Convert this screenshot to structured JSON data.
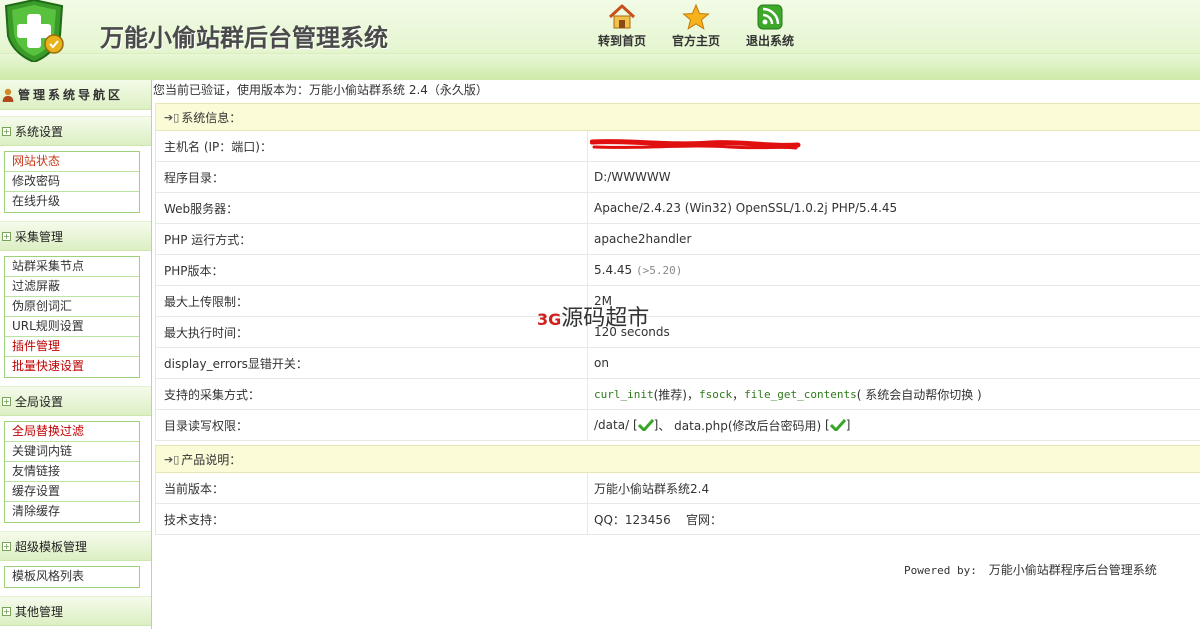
{
  "app": {
    "title": "万能小偷站群后台管理系统"
  },
  "topnav": [
    {
      "label": "转到首页",
      "icon": "home-icon"
    },
    {
      "label": "官方主页",
      "icon": "star-icon"
    },
    {
      "label": "退出系统",
      "icon": "rss-icon"
    }
  ],
  "sidebar": {
    "header": "管理系统导航区",
    "sections": [
      {
        "title": "系统设置",
        "items": [
          "网站状态",
          "修改密码",
          "在线升级"
        ]
      },
      {
        "title": "采集管理",
        "items": [
          "站群采集节点",
          "过滤屏蔽",
          "伪原创词汇",
          "URL规则设置",
          "插件管理",
          "批量快速设置"
        ]
      },
      {
        "title": "全局设置",
        "items": [
          "全局替换过滤",
          "关键词内链",
          "友情链接",
          "缓存设置",
          "清除缓存"
        ]
      },
      {
        "title": "超级模板管理",
        "items": [
          "模板风格列表"
        ]
      },
      {
        "title": "其他管理",
        "items": []
      }
    ]
  },
  "main": {
    "notice": "您当前已验证，使用版本为：万能小偷站群系统 2.4（永久版）",
    "sysinfo": {
      "title": "系统信息：",
      "rows": [
        {
          "label": "主机名 (IP：端口)：",
          "value": ""
        },
        {
          "label": "程序目录：",
          "value": "D:/WWWWW"
        },
        {
          "label": "Web服务器：",
          "value": "Apache/2.4.23 (Win32) OpenSSL/1.0.2j PHP/5.4.45"
        },
        {
          "label": "PHP 运行方式：",
          "value": "apache2handler"
        },
        {
          "label": "PHP版本：",
          "value": "5.4.45",
          "note": "(>5.20)"
        },
        {
          "label": "最大上传限制：",
          "value": "2M"
        },
        {
          "label": "最大执行时间：",
          "value": "120 seconds"
        },
        {
          "label": "display_errors显错开关：",
          "value": "on"
        },
        {
          "label": "支持的采集方式：",
          "methods": [
            "curl_init",
            "fsock",
            "file_get_contents"
          ],
          "recommend": "(推荐)",
          "sep": "，",
          "note": "( 系统会自动帮你切换 )"
        },
        {
          "label": "目录读写权限：",
          "dir1": "/data/",
          "dir2": "data.php(修改后台密码用)",
          "sep": "、"
        }
      ]
    },
    "product": {
      "title": "产品说明：",
      "rows": [
        {
          "label": "当前版本：",
          "value": "万能小偷站群系统2.4"
        },
        {
          "label": "技术支持：",
          "qq": "QQ：123456",
          "site": "官网："
        }
      ]
    },
    "powered": {
      "prefix": "Powered by:",
      "text": "万能小偷站群程序后台管理系统"
    },
    "watermark": {
      "brand": "3G",
      "text": "源码超市"
    }
  }
}
